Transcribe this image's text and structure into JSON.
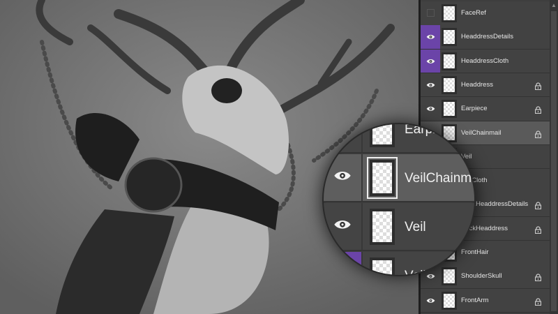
{
  "layers_panel": {
    "layers": [
      {
        "name": "FaceRef",
        "visible": false,
        "highlight": false,
        "locked": false
      },
      {
        "name": "HeaddressDetails",
        "visible": true,
        "highlight": true,
        "locked": false
      },
      {
        "name": "HeaddressCloth",
        "visible": true,
        "highlight": true,
        "locked": false
      },
      {
        "name": "Headdress",
        "visible": true,
        "highlight": false,
        "locked": true
      },
      {
        "name": "Earpiece",
        "visible": true,
        "highlight": false,
        "locked": true
      },
      {
        "name": "VeilChainmail",
        "visible": true,
        "highlight": false,
        "locked": true,
        "selected": true
      },
      {
        "name": "Veil",
        "visible": true,
        "highlight": false,
        "locked": false
      },
      {
        "name": "VeilCloth",
        "visible": true,
        "highlight": true,
        "locked": false
      },
      {
        "name": "BackHeaddressDetails",
        "visible": true,
        "highlight": false,
        "locked": true
      },
      {
        "name": "BackHeaddress",
        "visible": true,
        "highlight": false,
        "locked": true
      },
      {
        "name": "FrontHair",
        "visible": true,
        "highlight": false,
        "locked": false
      },
      {
        "name": "ShoulderSkull",
        "visible": true,
        "highlight": false,
        "locked": true
      },
      {
        "name": "FrontArm",
        "visible": true,
        "highlight": false,
        "locked": true
      }
    ]
  },
  "magnifier": {
    "rows": [
      {
        "name": "Earpiece"
      },
      {
        "name": "VeilChainmail",
        "selected": true
      },
      {
        "name": "Veil"
      },
      {
        "name": "VeilCloth",
        "highlight": true
      }
    ]
  },
  "colors": {
    "accent": "#6b44a8",
    "panel": "#3e3e3e",
    "selected_row": "#5a5a5a"
  }
}
